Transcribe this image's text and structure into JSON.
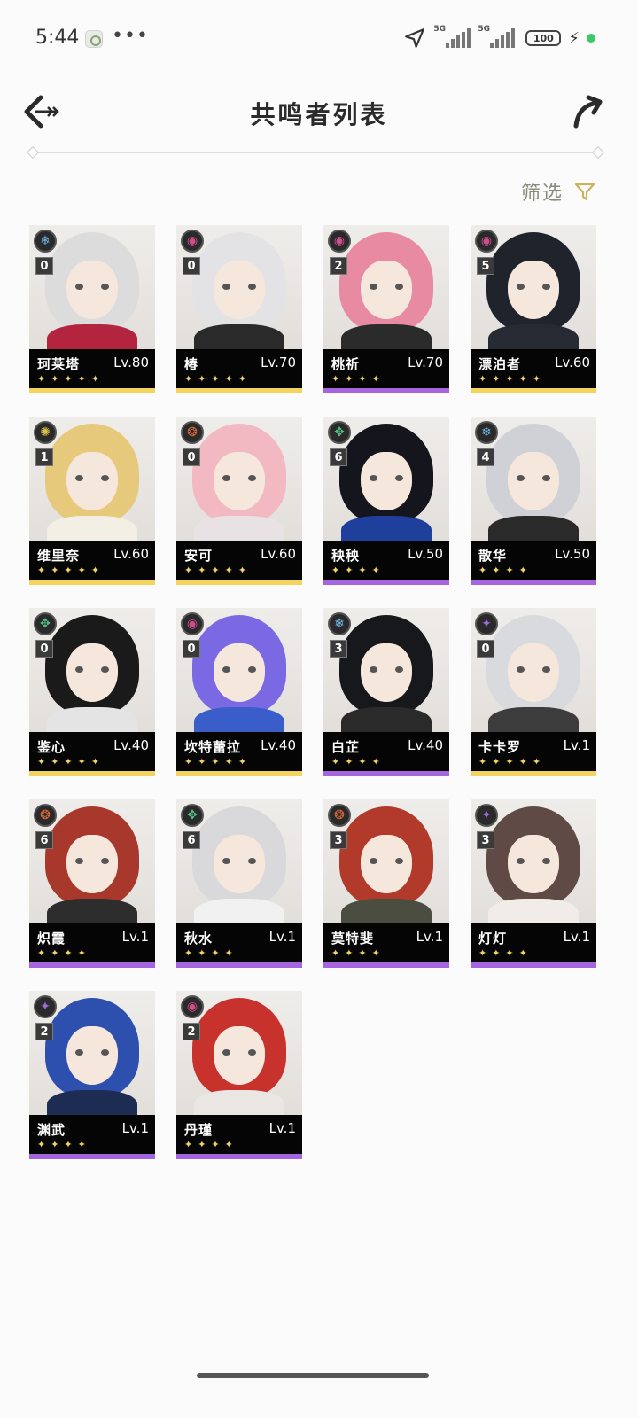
{
  "status_bar": {
    "time": "5:44",
    "more": "•••",
    "sim1": "5G",
    "sim2": "5G",
    "battery": "100"
  },
  "header": {
    "title": "共鸣者列表",
    "back_icon": "back-arrow-icon",
    "share_icon": "share-icon"
  },
  "filter": {
    "label": "筛选",
    "icon": "filter-icon",
    "accent_color": "#c9b35d"
  },
  "colors": {
    "five_star": "#f1d35e",
    "four_star": "#a565e0",
    "star": "#f0d36b"
  },
  "characters": [
    {
      "name": "珂莱塔",
      "level": "Lv.80",
      "seq": "0",
      "stars": "✦✦✦✦✦",
      "rarity": 5,
      "element": "glacio-icon",
      "hair": "#dcdcdc",
      "outfit": "#b3253f"
    },
    {
      "name": "椿",
      "level": "Lv.70",
      "seq": "0",
      "stars": "✦✦✦✦✦",
      "rarity": 5,
      "element": "havoc-icon",
      "hair": "#e3e3e6",
      "outfit": "#2a2a2a"
    },
    {
      "name": "桃祈",
      "level": "Lv.70",
      "seq": "2",
      "stars": "✦✦✦✦",
      "rarity": 4,
      "element": "havoc-icon",
      "hair": "#e98aa3",
      "outfit": "#2b2b2b"
    },
    {
      "name": "漂泊者",
      "level": "Lv.60",
      "seq": "5",
      "stars": "✦✦✦✦✦",
      "rarity": 5,
      "element": "havoc-icon",
      "hair": "#1f232b",
      "outfit": "#262a33"
    },
    {
      "name": "维里奈",
      "level": "Lv.60",
      "seq": "1",
      "stars": "✦✦✦✦✦",
      "rarity": 5,
      "element": "spectro-icon",
      "hair": "#e6c97a",
      "outfit": "#f3efe4"
    },
    {
      "name": "安可",
      "level": "Lv.60",
      "seq": "0",
      "stars": "✦✦✦✦✦",
      "rarity": 5,
      "element": "fusion-icon",
      "hair": "#f3b9c3",
      "outfit": "#e9e2e4"
    },
    {
      "name": "秧秧",
      "level": "Lv.50",
      "seq": "6",
      "stars": "✦✦✦✦",
      "rarity": 4,
      "element": "aero-icon",
      "hair": "#15161d",
      "outfit": "#1e3f9c"
    },
    {
      "name": "散华",
      "level": "Lv.50",
      "seq": "4",
      "stars": "✦✦✦✦",
      "rarity": 4,
      "element": "glacio-icon",
      "hair": "#cfd1d6",
      "outfit": "#2a2a2a"
    },
    {
      "name": "鉴心",
      "level": "Lv.40",
      "seq": "0",
      "stars": "✦✦✦✦✦",
      "rarity": 5,
      "element": "aero-icon",
      "hair": "#1a1a1a",
      "outfit": "#e4e4e4"
    },
    {
      "name": "坎特蕾拉",
      "level": "Lv.40",
      "seq": "0",
      "stars": "✦✦✦✦✦",
      "rarity": 5,
      "element": "havoc-icon",
      "hair": "#7a69e2",
      "outfit": "#3a5ec9"
    },
    {
      "name": "白芷",
      "level": "Lv.40",
      "seq": "3",
      "stars": "✦✦✦✦",
      "rarity": 4,
      "element": "glacio-icon",
      "hair": "#17181c",
      "outfit": "#2a2a2a"
    },
    {
      "name": "卡卡罗",
      "level": "Lv.1",
      "seq": "0",
      "stars": "✦✦✦✦✦",
      "rarity": 5,
      "element": "electro-icon",
      "hair": "#d9dadd",
      "outfit": "#3c3c3c"
    },
    {
      "name": "炽霞",
      "level": "Lv.1",
      "seq": "6",
      "stars": "✦✦✦✦",
      "rarity": 4,
      "element": "fusion-icon",
      "hair": "#a8382c",
      "outfit": "#2d2d2d"
    },
    {
      "name": "秋水",
      "level": "Lv.1",
      "seq": "6",
      "stars": "✦✦✦✦",
      "rarity": 4,
      "element": "aero-icon",
      "hair": "#d9d9dc",
      "outfit": "#f1f1f1"
    },
    {
      "name": "莫特斐",
      "level": "Lv.1",
      "seq": "3",
      "stars": "✦✦✦✦",
      "rarity": 4,
      "element": "fusion-icon",
      "hair": "#b13a2b",
      "outfit": "#4a4d3f"
    },
    {
      "name": "灯灯",
      "level": "Lv.1",
      "seq": "3",
      "stars": "✦✦✦✦",
      "rarity": 4,
      "element": "electro-icon",
      "hair": "#5f4a45",
      "outfit": "#f1ece8"
    },
    {
      "name": "渊武",
      "level": "Lv.1",
      "seq": "2",
      "stars": "✦✦✦✦",
      "rarity": 4,
      "element": "electro-icon",
      "hair": "#2d4fae",
      "outfit": "#1d2c52"
    },
    {
      "name": "丹瑾",
      "level": "Lv.1",
      "seq": "2",
      "stars": "✦✦✦✦",
      "rarity": 4,
      "element": "havoc-icon",
      "hair": "#c8322d",
      "outfit": "#eae6e2"
    }
  ]
}
